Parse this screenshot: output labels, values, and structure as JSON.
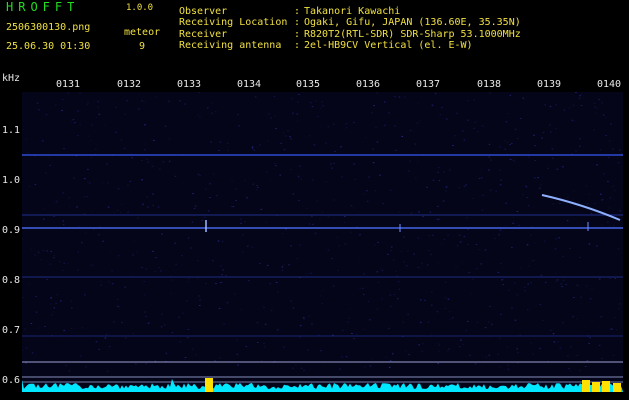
{
  "header": {
    "app_title": "HROFFT",
    "app_version": "1.0.0",
    "file_name": "2506300130.png",
    "meteor_label": "meteor",
    "datetime": "25.06.30 01:30",
    "meteor_count": "9"
  },
  "info": [
    {
      "key": "Observer",
      "value": "Takanori Kawachi"
    },
    {
      "key": "Receiving Location",
      "value": "Ogaki, Gifu, JAPAN (136.60E, 35.35N)"
    },
    {
      "key": "Receiver",
      "value": "R820T2(RTL-SDR) SDR-Sharp 53.1000MHz"
    },
    {
      "key": "Receiving antenna",
      "value": "2el-HB9CV Vertical (el. E-W)"
    }
  ],
  "separator": ":",
  "axis": {
    "y_unit": "kHz",
    "y_ticks": [
      "1.1",
      "1.0",
      "0.9",
      "0.8",
      "0.7",
      "0.6"
    ],
    "x_ticks": [
      "0131",
      "0132",
      "0133",
      "0134",
      "0135",
      "0136",
      "0137",
      "0138",
      "0139",
      "0140"
    ]
  },
  "colors": {
    "background": "#000000",
    "header_green": "#22dd22",
    "header_yellow": "#f0e040",
    "signal_blue": "#3060ff",
    "noise_cyan": "#00e8ff",
    "hot_yellow": "#ffe000"
  }
}
